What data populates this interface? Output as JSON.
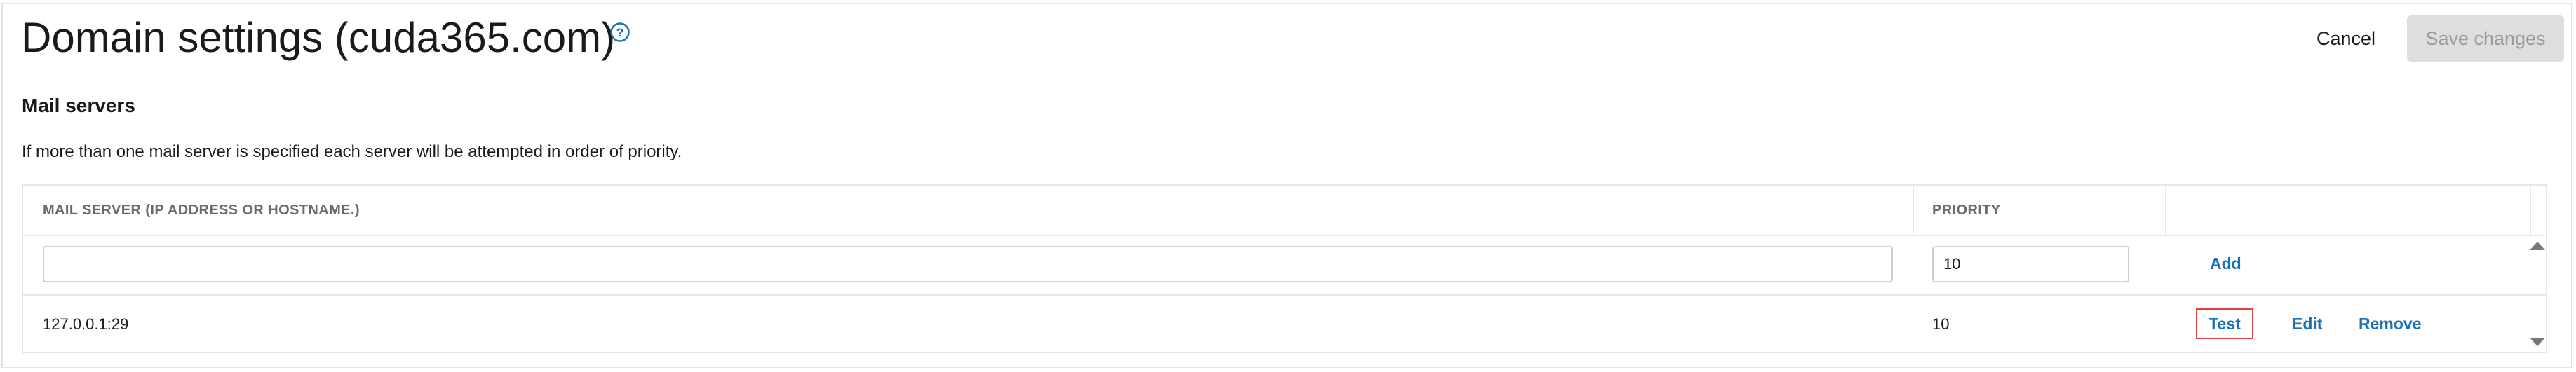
{
  "header": {
    "title": "Domain settings (cuda365.com)",
    "help_icon": "help-circle-icon",
    "cancel_label": "Cancel",
    "save_label": "Save changes"
  },
  "mail_servers": {
    "section_title": "Mail servers",
    "description": "If more than one mail server is specified each server will be attempted in order of priority.",
    "columns": [
      "MAIL SERVER (IP ADDRESS OR HOSTNAME.)",
      "PRIORITY",
      ""
    ],
    "new_entry": {
      "server_value": "",
      "priority_value": "10",
      "add_label": "Add"
    },
    "rows": [
      {
        "server": "127.0.0.1:29",
        "priority": "10",
        "test_label": "Test",
        "edit_label": "Edit",
        "remove_label": "Remove"
      }
    ]
  },
  "colors": {
    "link": "#1a6fb5",
    "highlight_border": "#e04040",
    "disabled_button_bg": "#dedede",
    "disabled_button_text": "#9a9a9a"
  }
}
